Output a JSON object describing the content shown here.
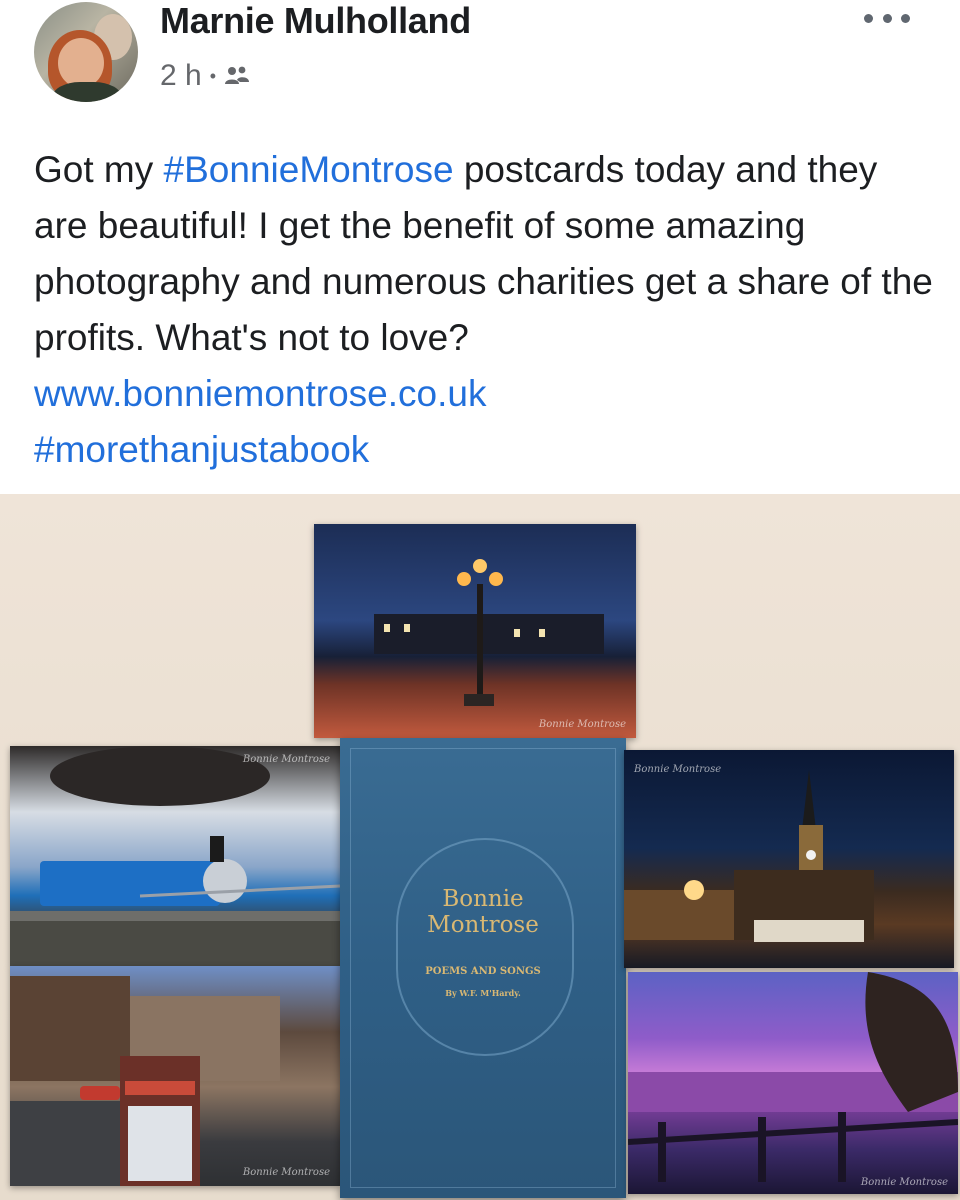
{
  "post": {
    "author": "Marnie Mulholland",
    "time": "2 h",
    "separator": "•",
    "audience_icon": "friends-icon",
    "more_icon": "more-horizontal-icon",
    "text": {
      "part1": "Got my ",
      "hashtag1": "#BonnieMontrose",
      "part2": " postcards today and they are beautiful! I get the benefit of some amazing photography and numerous charities get a share of the profits. What's not to love?",
      "link": "www.bonniemontrose.co.uk",
      "hashtag2": "#morethanjustabook"
    },
    "link_color": "#216fdb"
  },
  "photo": {
    "watermark": "Bonnie Montrose",
    "book": {
      "title_line1": "Bonnie",
      "title_line2": "Montrose",
      "subtitle": "POEMS AND SONGS",
      "author": "By W.F. M'Hardy."
    }
  }
}
